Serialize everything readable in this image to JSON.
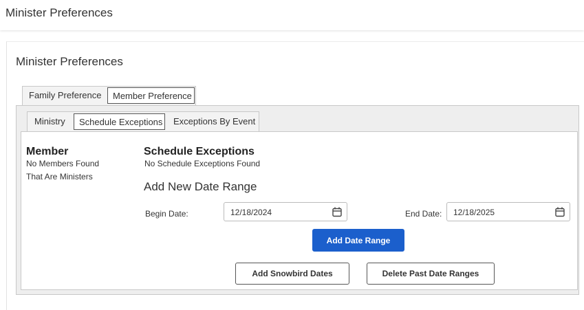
{
  "header": {
    "title": "Minister Preferences"
  },
  "page": {
    "title": "Minister Preferences"
  },
  "tabs_top": [
    {
      "label": "Family Preference",
      "active": false
    },
    {
      "label": "Member Preference",
      "active": true
    }
  ],
  "tabs_sub": [
    {
      "label": "Ministry",
      "active": false
    },
    {
      "label": "Schedule Exceptions",
      "active": true
    },
    {
      "label": "Exceptions By Event",
      "active": false
    }
  ],
  "member": {
    "heading": "Member",
    "empty_line1": "No Members Found",
    "empty_line2": "That Are Ministers"
  },
  "exceptions": {
    "heading": "Schedule Exceptions",
    "empty": "No Schedule Exceptions Found",
    "add_heading": "Add New Date Range",
    "begin_label": "Begin Date:",
    "begin_value": "12/18/2024",
    "end_label": "End Date:",
    "end_value": "12/18/2025"
  },
  "buttons": {
    "add_range": "Add Date Range",
    "snowbird": "Add Snowbird Dates",
    "delete_past": "Delete Past Date Ranges"
  },
  "colors": {
    "primary": "#1b5fcc"
  },
  "icons": {
    "date_picker": "calendar-icon"
  }
}
